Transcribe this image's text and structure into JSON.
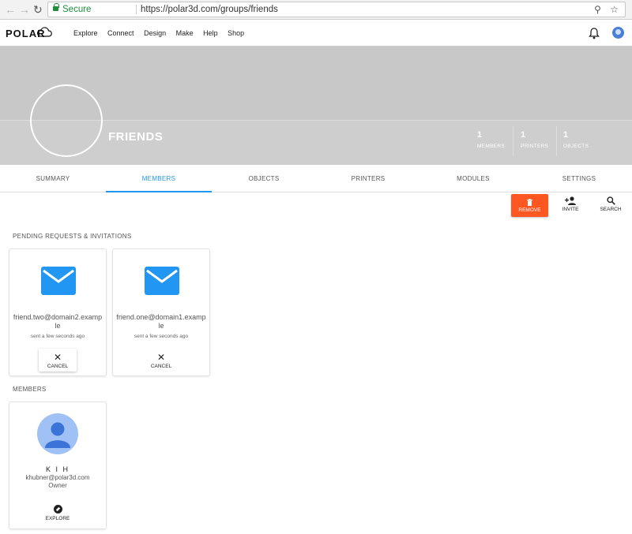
{
  "browser": {
    "secure_label": "Secure",
    "url": "https://polar3d.com/groups/friends"
  },
  "header": {
    "logo": "POLAR",
    "nav": [
      "Explore",
      "Connect",
      "Design",
      "Make",
      "Help",
      "Shop"
    ]
  },
  "group": {
    "title": "FRIENDS",
    "stats": [
      {
        "value": "1",
        "label": "MEMBERS"
      },
      {
        "value": "1",
        "label": "PRINTERS"
      },
      {
        "value": "1",
        "label": "OBJECTS"
      }
    ]
  },
  "tabs": [
    {
      "label": "SUMMARY"
    },
    {
      "label": "MEMBERS",
      "active": true
    },
    {
      "label": "OBJECTS"
    },
    {
      "label": "PRINTERS"
    },
    {
      "label": "MODULES"
    },
    {
      "label": "SETTINGS"
    }
  ],
  "toolbar": {
    "remove_label": "REMOVE",
    "invite_label": "INVITE",
    "search_label": "SEARCH"
  },
  "pending": {
    "heading": "PENDING REQUESTS & INVITATIONS",
    "items": [
      {
        "email": "friend.two@domain2.example",
        "sent": "sent a few seconds ago",
        "cancel_label": "CANCEL"
      },
      {
        "email": "friend.one@domain1.example",
        "sent": "sent a few seconds ago",
        "cancel_label": "CANCEL"
      }
    ]
  },
  "members": {
    "heading": "MEMBERS",
    "items": [
      {
        "name": "K I H",
        "email": "khubner@polar3d.com",
        "role": "Owner",
        "explore_label": "EXPLORE"
      }
    ]
  },
  "colors": {
    "accent": "#2196f3",
    "remove": "#ff5722",
    "banner": "#c8c8c8",
    "mail": "#2196f3"
  }
}
